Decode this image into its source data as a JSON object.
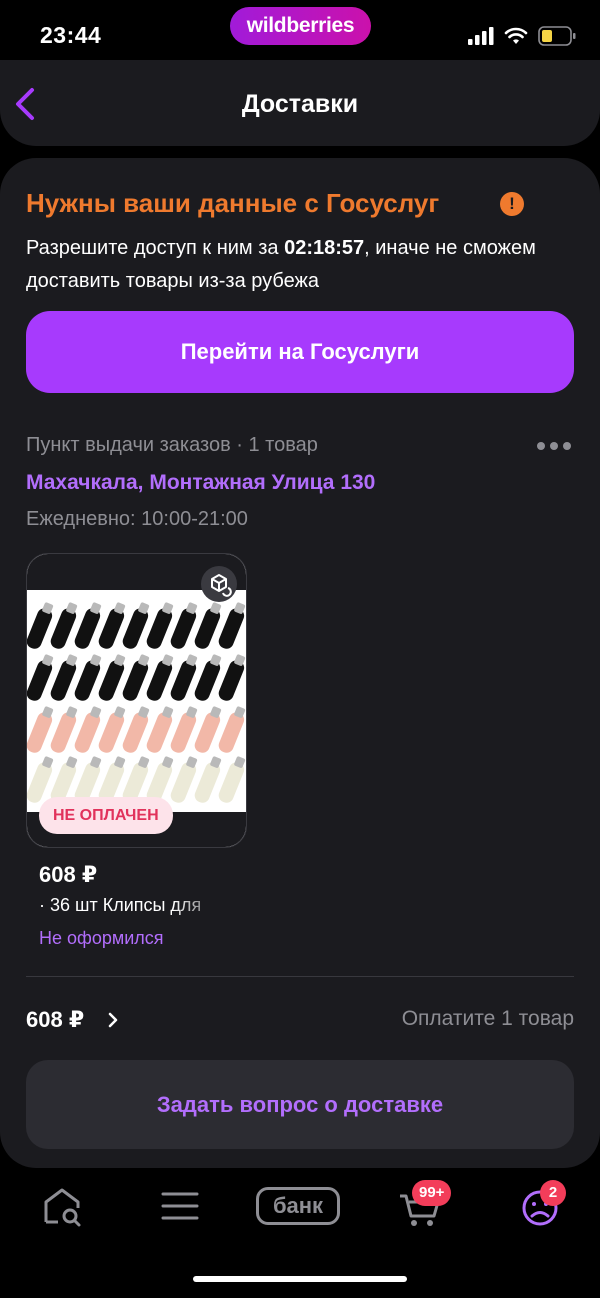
{
  "status_bar": {
    "time": "23:44",
    "brand": "wildberries"
  },
  "header": {
    "title": "Доставки",
    "back_icon": "chevron-left-icon"
  },
  "notice": {
    "title": "Нужны ваши данные с Госуслуг",
    "text_prefix": "Разрешите доступ к ним за ",
    "countdown": "02:18:57",
    "text_suffix": ", иначе не сможем доставить товары из-за рубежа",
    "button_label": "Перейти на Госуслуги"
  },
  "pickup": {
    "type_label": "Пункт выдачи заказов · 1 товар",
    "address": "Махачкала, Монтажная Улица 130",
    "hours": "Ежедневно: 10:00-21:00"
  },
  "product": {
    "badge": "НЕ ОПЛАЧЕН",
    "price": "608 ₽",
    "name": "· 36 шт Клипсы для",
    "status": "Не оформился"
  },
  "summary": {
    "total": "608 ₽",
    "pay_label": "Оплатите 1 товар"
  },
  "question_button_label": "Задать вопрос о доставке",
  "tabbar": {
    "items": [
      {
        "icon": "home-search-icon"
      },
      {
        "icon": "menu-icon"
      },
      {
        "label": "банк",
        "icon": "bank-icon"
      },
      {
        "icon": "cart-icon",
        "badge": "99+"
      },
      {
        "icon": "profile-icon",
        "badge": "2"
      }
    ]
  },
  "colors": {
    "accent": "#a73afd",
    "link": "#b26efc",
    "warning": "#ef7a2e",
    "badge": "#f33d5a",
    "card": "#1b1b1f"
  }
}
